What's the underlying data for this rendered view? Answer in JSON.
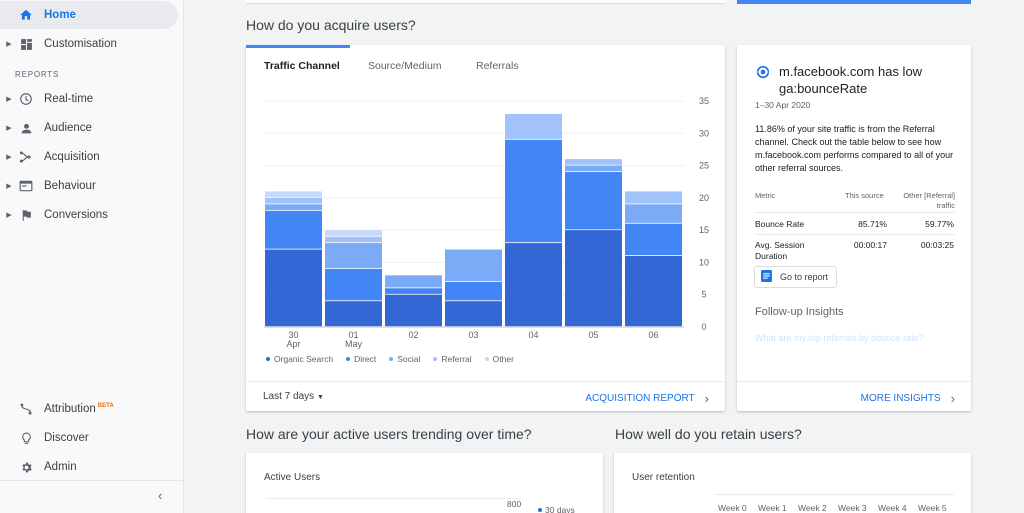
{
  "sidebar": {
    "home": "Home",
    "customisation": "Customisation",
    "reports_label": "REPORTS",
    "realtime": "Real-time",
    "audience": "Audience",
    "acquisition": "Acquisition",
    "behaviour": "Behaviour",
    "conversions": "Conversions",
    "attribution": "Attribution",
    "attribution_badge": "BETA",
    "discover": "Discover",
    "admin": "Admin",
    "collapse_icon": "chevron-left-icon"
  },
  "acquire": {
    "heading": "How do you acquire users?",
    "tabs": [
      "Traffic Channel",
      "Source/Medium",
      "Referrals"
    ],
    "date_range": "Last 7 days",
    "report_link": "ACQUISITION REPORT"
  },
  "chart_data": {
    "type": "bar",
    "stacked": true,
    "categories": [
      "30 Apr",
      "01 May",
      "02",
      "03",
      "04",
      "05",
      "06"
    ],
    "series": [
      {
        "name": "Organic Search",
        "color": "#3367d6",
        "values": [
          12,
          4,
          5,
          4,
          13,
          15,
          11
        ]
      },
      {
        "name": "Direct",
        "color": "#4285f4",
        "values": [
          6,
          5,
          1,
          3,
          16,
          9,
          5
        ]
      },
      {
        "name": "Social",
        "color": "#7baaf7",
        "values": [
          1,
          4,
          2,
          5,
          0,
          1,
          3
        ]
      },
      {
        "name": "Referral",
        "color": "#a1c2fa",
        "values": [
          1,
          1,
          0,
          0,
          4,
          1,
          2
        ]
      },
      {
        "name": "Other",
        "color": "#c6dafc",
        "values": [
          1,
          1,
          0,
          0,
          0,
          0,
          0
        ]
      }
    ],
    "yticks": [
      0,
      5,
      10,
      15,
      20,
      25,
      30,
      35
    ],
    "ylim": [
      0,
      35
    ],
    "grid": true,
    "legend_position": "bottom"
  },
  "insight": {
    "icon": "referral-icon",
    "title": "m.facebook.com has low ga:bounceRate",
    "date": "1–30 Apr 2020",
    "body": "11.86% of your site traffic is from the Referral channel. Check out the table below to see how m.facebook.com performs compared to all of your other referral sources.",
    "col_metric": "Metric",
    "col_source": "This source",
    "col_other": "Other [Referral] traffic",
    "rows": [
      {
        "metric": "Bounce Rate",
        "source": "85.71%",
        "other": "59.77%"
      },
      {
        "metric": "Avg. Session Duration",
        "source": "00:00:17",
        "other": "00:03:25"
      }
    ],
    "goto_label": "Go to report",
    "followup": "Follow-up Insights",
    "followup_question": "What are my top referrals by bounce rate?",
    "more": "MORE INSIGHTS"
  },
  "active": {
    "heading": "How are your active users trending over time?",
    "card_title": "Active Users",
    "tick_top": "800",
    "legend_30d": "30 days"
  },
  "retain": {
    "heading": "How well do you retain users?",
    "card_title": "User retention",
    "weeks": [
      "Week 0",
      "Week 1",
      "Week 2",
      "Week 3",
      "Week 4",
      "Week 5"
    ]
  }
}
